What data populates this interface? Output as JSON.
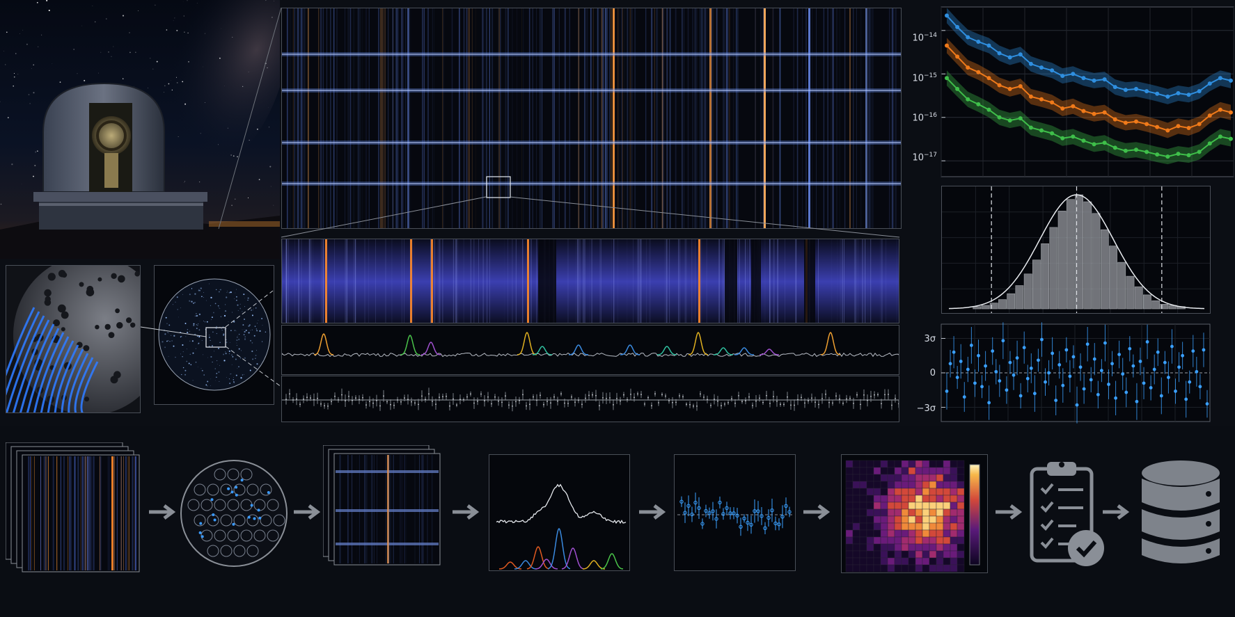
{
  "sensitivity_plot": {
    "y_tick_labels": [
      {
        "base": "10",
        "exp": "−14"
      },
      {
        "base": "10",
        "exp": "−15"
      },
      {
        "base": "10",
        "exp": "−16"
      },
      {
        "base": "10",
        "exp": "−17"
      }
    ],
    "series_colors": [
      "#2f8fe0",
      "#f07a1a",
      "#3fbf4a"
    ]
  },
  "residual_plot": {
    "y_tick_labels": [
      "3σ",
      "0",
      "−3σ"
    ],
    "point_color": "#3aa0ff"
  },
  "chart_data": [
    {
      "type": "line",
      "title": "",
      "xlabel": "",
      "ylabel": "",
      "y_scale": "log",
      "ylim": [
        5e-18,
        3e-14
      ],
      "grid": true,
      "x": [
        0,
        1,
        2,
        3,
        4,
        5,
        6,
        7,
        8,
        9,
        10,
        11,
        12,
        13,
        14,
        15,
        16,
        17,
        18,
        19,
        20,
        21,
        22,
        23,
        24,
        25,
        26,
        27
      ],
      "series": [
        {
          "color": "#2f8fe0",
          "values": [
            2.2e-14,
            1.2e-14,
            7e-15,
            5.5e-15,
            4.5e-15,
            3e-15,
            2.4e-15,
            2.8e-15,
            1.7e-15,
            1.4e-15,
            1.2e-15,
            9e-16,
            1e-15,
            8e-16,
            7e-16,
            7.5e-16,
            5e-16,
            4.3e-16,
            4.5e-16,
            4e-16,
            3.5e-16,
            3e-16,
            3.6e-16,
            3.3e-16,
            4e-16,
            6e-16,
            8e-16,
            7e-16
          ]
        },
        {
          "color": "#f07a1a",
          "values": [
            4.5e-15,
            2.5e-15,
            1.4e-15,
            1.1e-15,
            8e-16,
            5.5e-16,
            4.5e-16,
            5.2e-16,
            3e-16,
            2.6e-16,
            2.2e-16,
            1.6e-16,
            1.8e-16,
            1.4e-16,
            1.2e-16,
            1.3e-16,
            9e-17,
            7.5e-17,
            8e-17,
            7e-17,
            6e-17,
            5e-17,
            6.3e-17,
            5.7e-17,
            7e-17,
            1.1e-16,
            1.5e-16,
            1.3e-16
          ]
        },
        {
          "color": "#3fbf4a",
          "values": [
            8e-16,
            4.5e-16,
            2.6e-16,
            2e-16,
            1.5e-16,
            1e-16,
            8.5e-17,
            9.5e-17,
            5.8e-17,
            5e-17,
            4.3e-17,
            3.3e-17,
            3.6e-17,
            2.9e-17,
            2.4e-17,
            2.6e-17,
            2e-17,
            1.7e-17,
            1.8e-17,
            1.6e-17,
            1.4e-17,
            1.25e-17,
            1.45e-17,
            1.35e-17,
            1.6e-17,
            2.5e-17,
            3.6e-17,
            3.2e-17
          ]
        }
      ]
    },
    {
      "type": "bar",
      "title": "",
      "xlabel": "",
      "ylabel": "",
      "xlim": [
        -4.5,
        4.5
      ],
      "bin_centers": [
        -3.5,
        -3.2,
        -2.9,
        -2.6,
        -2.3,
        -2.0,
        -1.7,
        -1.4,
        -1.1,
        -0.8,
        -0.5,
        -0.2,
        0.1,
        0.4,
        0.7,
        1.0,
        1.3,
        1.6,
        1.9,
        2.2,
        2.5,
        2.8,
        3.1,
        3.4,
        3.7
      ],
      "values": [
        2,
        3,
        5,
        8,
        13,
        20,
        30,
        42,
        56,
        70,
        84,
        94,
        98,
        92,
        82,
        68,
        54,
        40,
        28,
        19,
        12,
        7,
        4,
        3,
        2
      ],
      "curve": "gaussian",
      "vlines": [
        -3,
        0,
        3
      ]
    },
    {
      "type": "scatter",
      "title": "",
      "xlabel": "",
      "ylabel": "",
      "ylim": [
        -4,
        4
      ],
      "reference_line": 0,
      "values": [
        -1.6,
        0.8,
        1.8,
        -0.4,
        1.0,
        -2.1,
        0.3,
        2.4,
        -0.9,
        1.5,
        -1.2,
        0.6,
        -2.6,
        1.9,
        0.1,
        -0.7,
        2.8,
        -1.5,
        0.9,
        -0.2,
        1.3,
        -2.0,
        2.2,
        -0.5,
        0.4,
        -1.8,
        1.1,
        2.9,
        -0.8,
        0.0,
        1.7,
        -2.4,
        0.7,
        -1.1,
        2.0,
        -0.3,
        1.4,
        -2.8,
        0.5,
        -1.4,
        2.5,
        -0.6,
        1.2,
        -1.9,
        0.2,
        2.6,
        -1.0,
        0.8,
        -2.2,
        1.6,
        -0.1,
        -1.7,
        2.1,
        0.6,
        -2.5,
        1.0,
        -0.9,
        2.7,
        -1.3,
        0.3,
        1.8,
        -2.0,
        0.9,
        -0.4,
        2.3,
        -1.6,
        0.5,
        1.5,
        -2.3,
        -0.8,
        1.9,
        0.1,
        -1.2,
        2.0,
        -2.7
      ],
      "errors": [
        1.6,
        1.2,
        1.4,
        1.0,
        1.5,
        1.3,
        1.1,
        1.6,
        1.2,
        1.4,
        1.0,
        1.3,
        1.5,
        1.2,
        1.1,
        1.4,
        1.6,
        1.2,
        1.0,
        1.3,
        1.5,
        1.1,
        1.4,
        1.2,
        1.3,
        1.6,
        1.0,
        1.5,
        1.2,
        1.1,
        1.4,
        1.3,
        1.2,
        1.5,
        1.1,
        1.4,
        1.0,
        1.6,
        1.2,
        1.3,
        1.5,
        1.1,
        1.4,
        1.2,
        1.0,
        1.6,
        1.3,
        1.1,
        1.5,
        1.2,
        1.4,
        1.3,
        1.1,
        1.0,
        1.6,
        1.2,
        1.4,
        1.5,
        1.1,
        1.3,
        1.2,
        1.6,
        1.0,
        1.4,
        1.5,
        1.1,
        1.3,
        1.2,
        1.6,
        1.0,
        1.4,
        1.3,
        1.1,
        1.5,
        1.2
      ]
    }
  ]
}
